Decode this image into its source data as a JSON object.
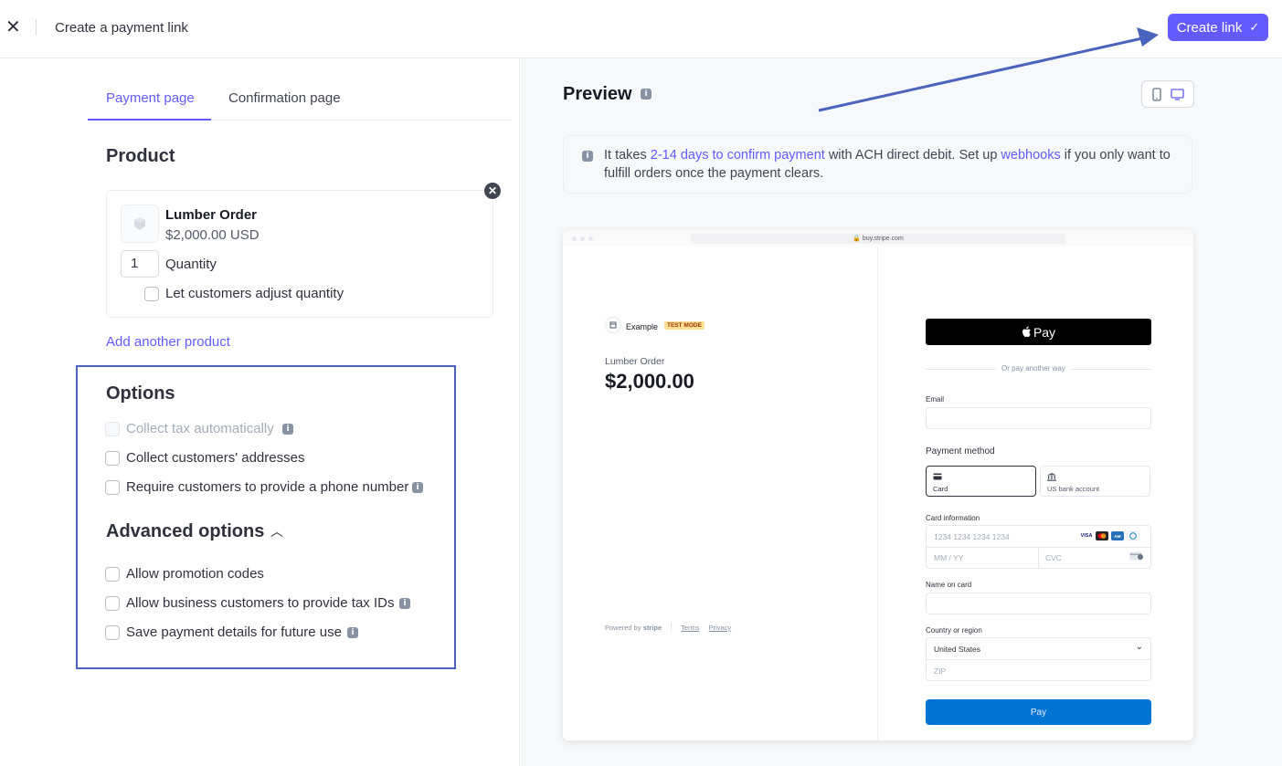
{
  "topbar": {
    "close_icon": "close-icon",
    "title": "Create a payment link",
    "create_button": "Create link",
    "create_icon": "checkmark-icon",
    "accent": "#635bff"
  },
  "tabs": [
    {
      "label": "Payment page",
      "active": true
    },
    {
      "label": "Confirmation page",
      "active": false
    }
  ],
  "product": {
    "heading": "Product",
    "name": "Lumber Order",
    "price": "$2,000.00 USD",
    "quantity": "1",
    "quantity_label": "Quantity",
    "adjust_label": "Let customers adjust quantity",
    "add_another": "Add another product"
  },
  "options": {
    "heading": "Options",
    "items": [
      {
        "label": "Collect tax automatically",
        "disabled": true,
        "info": true
      },
      {
        "label": "Collect customers' addresses",
        "disabled": false,
        "info": false
      },
      {
        "label": "Require customers to provide a phone number",
        "disabled": false,
        "info": true
      }
    ]
  },
  "advanced": {
    "heading": "Advanced options",
    "items": [
      {
        "label": "Allow promotion codes",
        "info": false
      },
      {
        "label": "Allow business customers to provide tax IDs",
        "info": true
      },
      {
        "label": "Save payment details for future use",
        "info": true
      }
    ]
  },
  "preview": {
    "title": "Preview",
    "notice": {
      "part1": "It takes ",
      "link1": "2-14 days to confirm payment",
      "part2": " with ACH direct debit. Set up ",
      "link2": "webhooks",
      "part3": " if you only want to fulfill orders once the payment clears."
    },
    "url": "buy.stripe.com",
    "checkout": {
      "merchant": "Example",
      "badge": "TEST MODE",
      "product": "Lumber Order",
      "price": "$2,000.00",
      "powered_by": "Powered by",
      "stripe": "stripe",
      "terms": "Terms",
      "privacy": "Privacy",
      "apple_pay": "Pay",
      "or_text": "Or pay another way",
      "email_label": "Email",
      "payment_method_label": "Payment method",
      "pm_card": "Card",
      "pm_bank": "US bank account",
      "card_info_label": "Card information",
      "card_number_ph": "1234 1234 1234 1234",
      "expiry_ph": "MM / YY",
      "cvc_ph": "CVC",
      "name_label": "Name on card",
      "country_label": "Country or region",
      "country_value": "United States",
      "zip_ph": "ZIP",
      "pay_button": "Pay",
      "pay_color": "#0074d4"
    }
  },
  "annotation_colors": {
    "arrow": "#4a64bd",
    "box": "#4a64bd"
  }
}
